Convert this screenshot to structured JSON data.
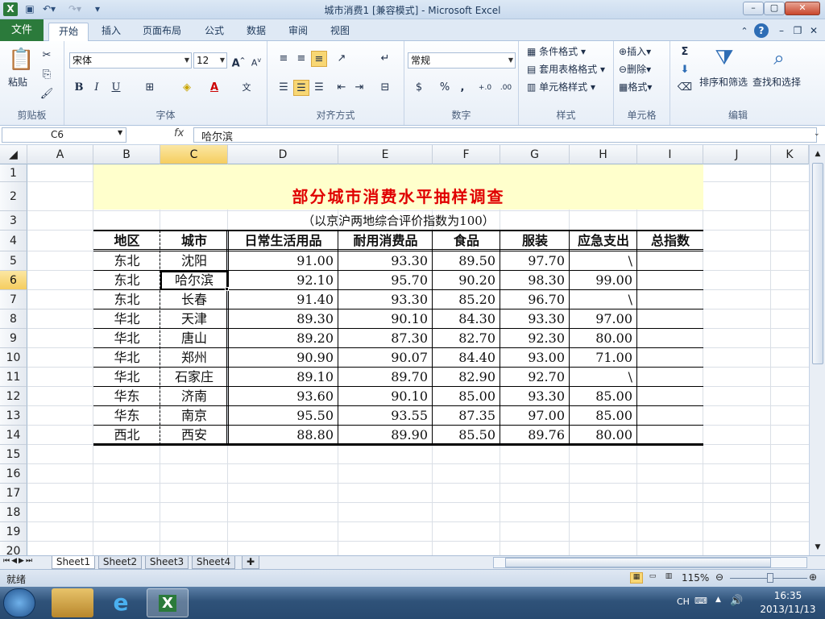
{
  "window": {
    "title": "城市消费1  [兼容模式] - Microsoft Excel"
  },
  "tabs": [
    "文件",
    "开始",
    "插入",
    "页面布局",
    "公式",
    "数据",
    "审阅",
    "视图"
  ],
  "ribbon": {
    "clipboard": {
      "label": "剪贴板",
      "paste": "粘贴"
    },
    "font": {
      "label": "字体",
      "name": "宋体",
      "size": "12",
      "bold": "B",
      "italic": "I",
      "underline": "U"
    },
    "alignment": {
      "label": "对齐方式"
    },
    "number": {
      "label": "数字",
      "format": "常规",
      "percent": "%",
      "comma": ",",
      "inc": "+.0",
      "dec": ".00"
    },
    "styles": {
      "label": "样式",
      "cond": "条件格式",
      "table": "套用表格格式",
      "cell": "单元格样式"
    },
    "cells": {
      "label": "单元格",
      "insert": "插入",
      "delete": "删除",
      "format": "格式"
    },
    "editing": {
      "label": "编辑",
      "sort": "排序和筛选",
      "find": "查找和选择",
      "sum": "Σ"
    }
  },
  "formula_bar": {
    "cell_ref": "C6",
    "fx": "fx",
    "value": "哈尔滨"
  },
  "columns": [
    "A",
    "B",
    "C",
    "D",
    "E",
    "F",
    "G",
    "H",
    "I",
    "J",
    "K"
  ],
  "rows": [
    "1",
    "2",
    "3",
    "4",
    "5",
    "6",
    "7",
    "8",
    "9",
    "10",
    "11",
    "12",
    "13",
    "14",
    "15",
    "16",
    "17",
    "18",
    "19",
    "20"
  ],
  "table": {
    "title": "部分城市消费水平抽样调查",
    "subtitle": "（以京沪两地综合评价指数为100）",
    "headers": [
      "地区",
      "城市",
      "日常生活用品",
      "耐用消费品",
      "食品",
      "服装",
      "应急支出",
      "总指数"
    ],
    "rows": [
      [
        "东北",
        "沈阳",
        "91.00",
        "93.30",
        "89.50",
        "97.70",
        "\\",
        ""
      ],
      [
        "东北",
        "哈尔滨",
        "92.10",
        "95.70",
        "90.20",
        "98.30",
        "99.00",
        ""
      ],
      [
        "东北",
        "长春",
        "91.40",
        "93.30",
        "85.20",
        "96.70",
        "\\",
        ""
      ],
      [
        "华北",
        "天津",
        "89.30",
        "90.10",
        "84.30",
        "93.30",
        "97.00",
        ""
      ],
      [
        "华北",
        "唐山",
        "89.20",
        "87.30",
        "82.70",
        "92.30",
        "80.00",
        ""
      ],
      [
        "华北",
        "郑州",
        "90.90",
        "90.07",
        "84.40",
        "93.00",
        "71.00",
        ""
      ],
      [
        "华北",
        "石家庄",
        "89.10",
        "89.70",
        "82.90",
        "92.70",
        "\\",
        ""
      ],
      [
        "华东",
        "济南",
        "93.60",
        "90.10",
        "85.00",
        "93.30",
        "85.00",
        ""
      ],
      [
        "华东",
        "南京",
        "95.50",
        "93.55",
        "87.35",
        "97.00",
        "85.00",
        ""
      ],
      [
        "西北",
        "西安",
        "88.80",
        "89.90",
        "85.50",
        "89.76",
        "80.00",
        ""
      ]
    ]
  },
  "sheets": [
    "Sheet1",
    "Sheet2",
    "Sheet3",
    "Sheet4"
  ],
  "status": {
    "mode": "就绪",
    "zoom": "115%"
  },
  "taskbar": {
    "lang": "CH",
    "time": "16:35",
    "date": "2013/11/13"
  }
}
